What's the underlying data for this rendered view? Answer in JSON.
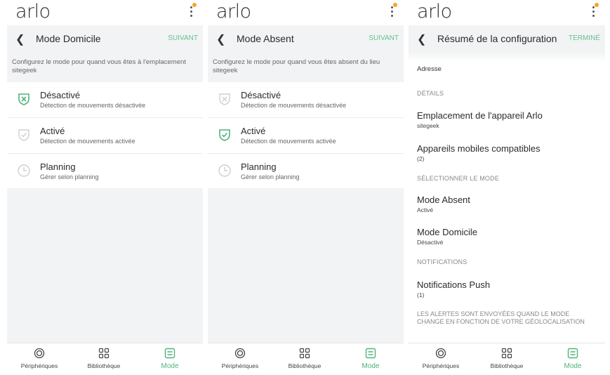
{
  "colors": {
    "accent": "#65c18c",
    "active_icon": "#4fb37a",
    "notification_dot": "#f5a623",
    "gray_bg": "#f2f3f4"
  },
  "panels": [
    {
      "logo": "arlo",
      "nav": {
        "back_icon": "chevron-left-icon",
        "title": "Mode Domicile",
        "action": "SUIVANT"
      },
      "description": "Configurez le mode pour quand vous êtes à l'emplacement sitegeek",
      "options": [
        {
          "title": "Désactivé",
          "subtitle": "Détection de mouvements désactivée",
          "icon": "shield-x-icon",
          "selected": true
        },
        {
          "title": "Activé",
          "subtitle": "Détection de mouvements activée",
          "icon": "shield-check-icon",
          "selected": false
        },
        {
          "title": "Planning",
          "subtitle": "Gérer selon planning",
          "icon": "clock-icon",
          "selected": false
        }
      ]
    },
    {
      "logo": "arlo",
      "nav": {
        "back_icon": "chevron-left-icon",
        "title": "Mode Absent",
        "action": "SUIVANT"
      },
      "description": "Configurez le mode pour quand vous êtes absent du lieu sitegeek",
      "options": [
        {
          "title": "Désactivé",
          "subtitle": "Détection de mouvements désactivée",
          "icon": "shield-x-icon",
          "selected": false
        },
        {
          "title": "Activé",
          "subtitle": "Détection de mouvements activée",
          "icon": "shield-check-icon",
          "selected": true
        },
        {
          "title": "Planning",
          "subtitle": "Gérer selon planning",
          "icon": "clock-icon",
          "selected": false
        }
      ]
    },
    {
      "logo": "arlo",
      "nav": {
        "back_icon": "chevron-left-icon",
        "title": "Résumé de la configuration",
        "action": "TERMINÉ"
      },
      "summary": {
        "address_label": "Adresse",
        "details_header": "DÉTAILS",
        "location_title": "Emplacement de l'appareil Arlo",
        "location_value": "sitegeek",
        "devices_title": "Appareils mobiles compatibles",
        "devices_value": "(2)",
        "select_mode_header": "SÉLECTIONNER LE MODE",
        "away_title": "Mode Absent",
        "away_value": "Activé",
        "home_title": "Mode Domicile",
        "home_value": "Désactivé",
        "notifications_header": "NOTIFICATIONS",
        "push_title": "Notifications Push",
        "push_value": "(1)",
        "alerts_note": "LES ALERTES SONT ENVOYÉES QUAND LE MODE CHANGE EN FONCTION DE VOTRE GÉOLOCALISATION"
      }
    }
  ],
  "tabs": [
    {
      "label": "Périphériques",
      "icon": "devices-icon"
    },
    {
      "label": "Bibliothèque",
      "icon": "library-grid-icon"
    },
    {
      "label": "Mode",
      "icon": "mode-icon",
      "active": true
    }
  ]
}
